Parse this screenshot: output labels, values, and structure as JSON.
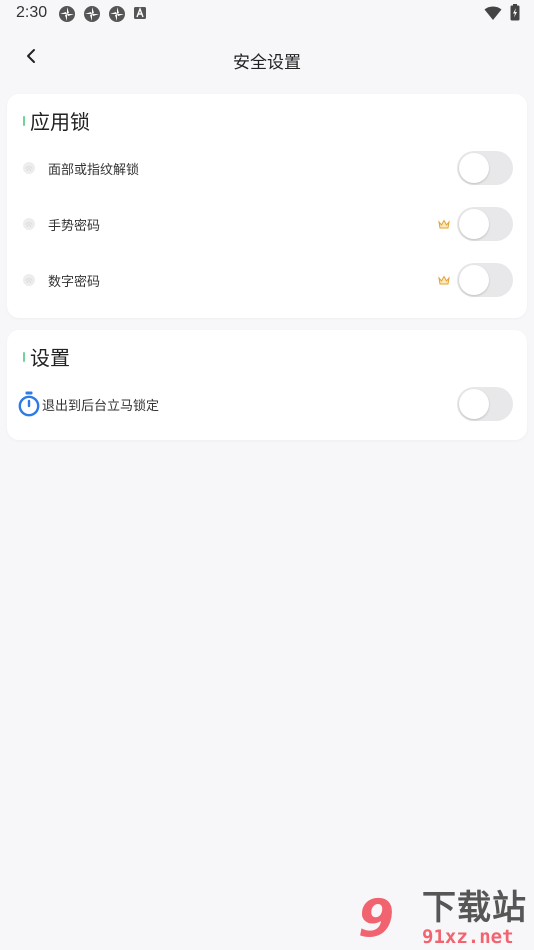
{
  "status_bar": {
    "time": "2:30",
    "left_icons": [
      "pinwheel-icon",
      "pinwheel-icon",
      "pinwheel-icon",
      "a-box-icon"
    ],
    "right_icons": [
      "wifi-icon",
      "battery-charging-icon"
    ]
  },
  "app_bar": {
    "title": "安全设置",
    "back_icon": "chevron-left-icon"
  },
  "app_lock": {
    "title": "应用锁",
    "items": [
      {
        "label": "面部或指纹解锁",
        "icon": "fingerprint-icon",
        "premium": false,
        "enabled": false
      },
      {
        "label": "手势密码",
        "icon": "fingerprint-icon",
        "premium": true,
        "enabled": false
      },
      {
        "label": "数字密码",
        "icon": "fingerprint-icon",
        "premium": true,
        "enabled": false
      }
    ]
  },
  "settings": {
    "title": "设置",
    "items": [
      {
        "label": "退出到后台立马锁定",
        "icon": "timer-icon",
        "enabled": false
      }
    ]
  },
  "watermark": {
    "title": "下载站",
    "url": "91xz.net",
    "logo_mark": "9"
  },
  "colors": {
    "background": "#f7f7f9",
    "card": "#ffffff",
    "section_mark": "#6fd39a",
    "toggle_off": "#e8e8ea",
    "timer_icon": "#2d7be5",
    "crown": "#e0a23a",
    "watermark_red": "#ef4a57"
  }
}
